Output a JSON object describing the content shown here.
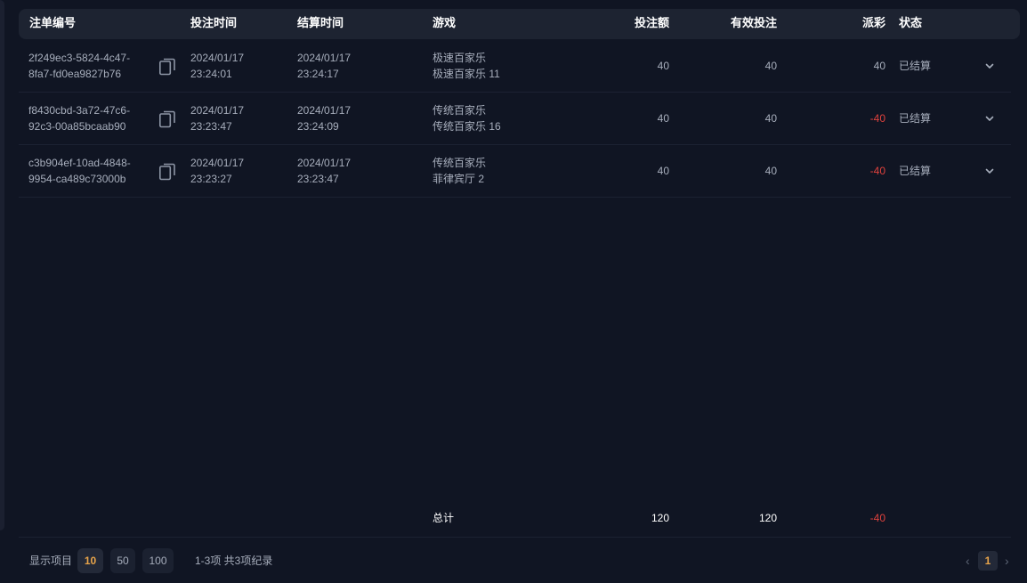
{
  "columns": {
    "order_id": "注单编号",
    "bet_time": "投注时间",
    "settle_time": "结算时间",
    "game": "游戏",
    "bet_amount": "投注额",
    "valid_bet": "有效投注",
    "payout": "派彩",
    "status": "状态"
  },
  "rows": [
    {
      "order_id_line1": "2f249ec3-5824-4c47-",
      "order_id_line2": "8fa7-fd0ea9827b76",
      "bet_date": "2024/01/17",
      "bet_clock": "23:24:01",
      "settle_date": "2024/01/17",
      "settle_clock": "23:24:17",
      "game_name": "极速百家乐",
      "game_table": "极速百家乐 11",
      "bet_amount": "40",
      "valid_bet": "40",
      "payout": "40",
      "status": "已结算"
    },
    {
      "order_id_line1": "f8430cbd-3a72-47c6-",
      "order_id_line2": "92c3-00a85bcaab90",
      "bet_date": "2024/01/17",
      "bet_clock": "23:23:47",
      "settle_date": "2024/01/17",
      "settle_clock": "23:24:09",
      "game_name": "传统百家乐",
      "game_table": "传统百家乐 16",
      "bet_amount": "40",
      "valid_bet": "40",
      "payout": "-40",
      "status": "已结算"
    },
    {
      "order_id_line1": "c3b904ef-10ad-4848-",
      "order_id_line2": "9954-ca489c73000b",
      "bet_date": "2024/01/17",
      "bet_clock": "23:23:27",
      "settle_date": "2024/01/17",
      "settle_clock": "23:23:47",
      "game_name": "传统百家乐",
      "game_table": "菲律宾厅 2",
      "bet_amount": "40",
      "valid_bet": "40",
      "payout": "-40",
      "status": "已结算"
    }
  ],
  "totals": {
    "label": "总计",
    "bet_amount": "120",
    "valid_bet": "120",
    "payout": "-40"
  },
  "footer": {
    "page_size_label": "显示项目",
    "page_sizes": [
      "10",
      "50",
      "100"
    ],
    "selected_page_size": "10",
    "range_text": "1-3项 共3项纪录",
    "current_page": "1",
    "prev_icon": "chevron-left-icon",
    "next_icon": "chevron-right-icon"
  },
  "icons": {
    "copy": "copy-icon",
    "expand": "chevron-down-icon"
  },
  "colors": {
    "background": "#101523",
    "header_bg": "#1d2331",
    "negative": "#e0423d",
    "accent": "#e8a44a"
  }
}
